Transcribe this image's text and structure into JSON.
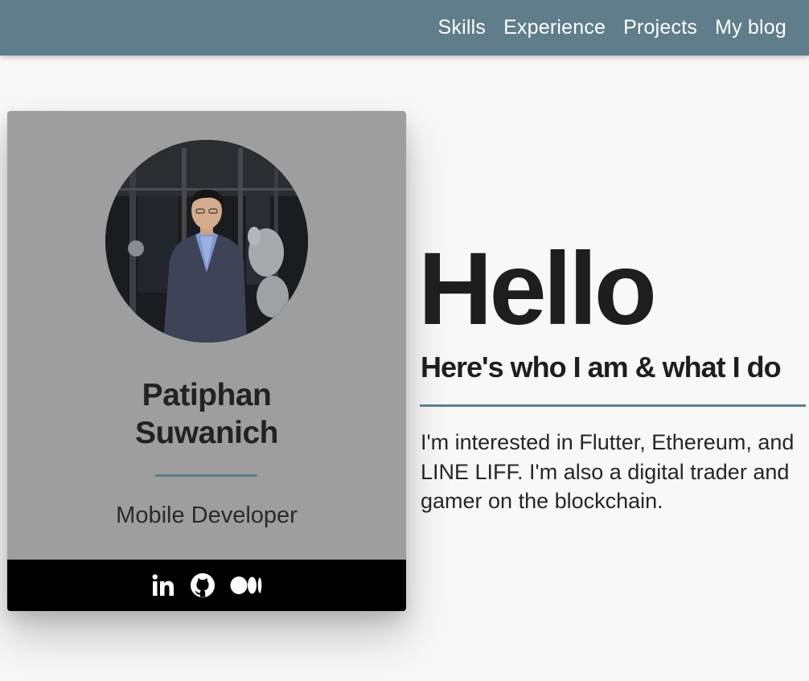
{
  "nav": {
    "links": [
      "Skills",
      "Experience",
      "Projects",
      "My blog"
    ]
  },
  "profile": {
    "name": "Patiphan Suwanich",
    "role": "Mobile Developer",
    "social": [
      {
        "icon": "linkedin-icon"
      },
      {
        "icon": "github-icon"
      },
      {
        "icon": "medium-icon"
      }
    ]
  },
  "hero": {
    "greeting": "Hello",
    "subtitle": "Here's who I am & what I do",
    "bio": "I'm interested in Flutter, Ethereum, and LINE LIFF. I'm also a digital trader and gamer on the blockchain."
  },
  "colors": {
    "navbar": "#5f7d8b",
    "accent": "#5f7d8b",
    "card": "#9e9e9e",
    "card_footer": "#000000",
    "page_background": "#f8f8f8"
  }
}
